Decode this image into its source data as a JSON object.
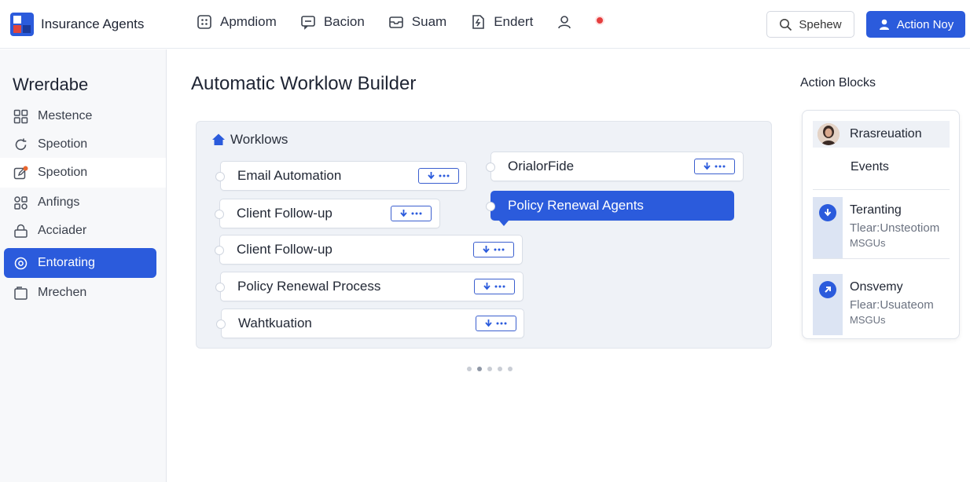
{
  "app": {
    "name": "Insurance Agents"
  },
  "nav": {
    "items": [
      {
        "label": "Apmdiom",
        "icon": "grid-icon"
      },
      {
        "label": "Bacion",
        "icon": "message-icon"
      },
      {
        "label": "Suam",
        "icon": "inbox-icon"
      },
      {
        "label": "Endert",
        "icon": "document-icon"
      }
    ],
    "search_label": "Spehew",
    "action_label": "Action Noy"
  },
  "sidebar": {
    "title": "Wrerdabe",
    "items": [
      {
        "label": "Mestence",
        "icon": "grid-icon"
      },
      {
        "label": "Speotion",
        "icon": "refresh-icon"
      },
      {
        "label": "Speotion",
        "icon": "edit-icon"
      },
      {
        "label": "Anfings",
        "icon": "apps-icon"
      },
      {
        "label": "Acciader",
        "icon": "lock-icon"
      },
      {
        "label": "Entorating",
        "icon": "gear-icon"
      },
      {
        "label": "Mrechen",
        "icon": "folder-icon"
      }
    ]
  },
  "main": {
    "title": "Automatic Worklow Builder",
    "panel_title": "Worklows",
    "workflows": [
      {
        "label": "Email Automation"
      },
      {
        "label": "Client Follow-up"
      },
      {
        "label": "Client Follow-up"
      },
      {
        "label": "Policy Renewal Process"
      },
      {
        "label": "Wahtkuation"
      },
      {
        "label": "OrialorFide"
      },
      {
        "label": "Policy Renewal Agents"
      }
    ]
  },
  "right_panel": {
    "title": "Action Blocks",
    "top_item": "Rrasreuation",
    "events_label": "Events",
    "blocks": [
      {
        "title": "Teranting",
        "subtitle": "Tlear:Unsteotiom",
        "tag": "MSGUs"
      },
      {
        "title": "Onsvemy",
        "subtitle": "Flear:Usuateom",
        "tag": "MSGUs"
      }
    ]
  },
  "colors": {
    "accent": "#2b5bdc",
    "panel_bg": "#eff2f7",
    "notification": "#e53e3e"
  }
}
